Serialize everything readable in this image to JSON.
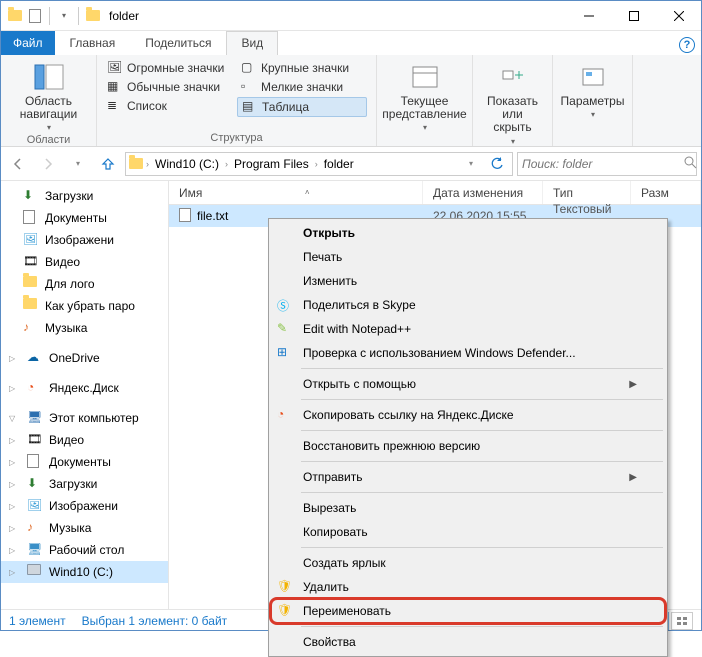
{
  "title": "folder",
  "tabs": {
    "file": "Файл",
    "home": "Главная",
    "share": "Поделиться",
    "view": "Вид"
  },
  "ribbon": {
    "nav_pane": "Область навигации",
    "group_areas": "Области",
    "huge_icons": "Огромные значки",
    "large_icons": "Крупные значки",
    "normal_icons": "Обычные значки",
    "small_icons": "Мелкие значки",
    "list": "Список",
    "table": "Таблица",
    "group_layout": "Структура",
    "current_view": "Текущее представление",
    "show_hide": "Показать или скрыть",
    "options": "Параметры"
  },
  "breadcrumb": [
    "Wind10 (C:)",
    "Program Files",
    "folder"
  ],
  "search_placeholder": "Поиск: folder",
  "sidebar": {
    "downloads": "Загрузки",
    "documents": "Документы",
    "pictures": "Изображени",
    "videos": "Видео",
    "for_logo": "Для лого",
    "how_remove": "Как убрать паро",
    "music": "Музыка",
    "onedrive": "OneDrive",
    "yandex_disk": "Яндекс.Диск",
    "this_pc": "Этот компьютер",
    "pc_videos": "Видео",
    "pc_documents": "Документы",
    "pc_downloads": "Загрузки",
    "pc_pictures": "Изображени",
    "pc_music": "Музыка",
    "pc_desktop": "Рабочий стол",
    "pc_disk": "Wind10 (C:)"
  },
  "columns": {
    "name": "Имя",
    "date": "Дата изменения",
    "type": "Тип",
    "size": "Разм"
  },
  "file": {
    "name": "file.txt",
    "date": "22.06.2020 15:55",
    "type": "Текстовый докум..."
  },
  "ctx": {
    "open": "Открыть",
    "print": "Печать",
    "edit": "Изменить",
    "skype": "Поделиться в Skype",
    "notepad": "Edit with Notepad++",
    "defender": "Проверка с использованием Windows Defender...",
    "open_with": "Открыть с помощью",
    "yandex_copy": "Скопировать ссылку на Яндекс.Диске",
    "restore": "Восстановить прежнюю версию",
    "send_to": "Отправить",
    "cut": "Вырезать",
    "copy": "Копировать",
    "shortcut": "Создать ярлык",
    "delete": "Удалить",
    "rename": "Переименовать",
    "properties": "Свойства"
  },
  "status": {
    "count": "1 элемент",
    "selected": "Выбран 1 элемент: 0 байт"
  }
}
